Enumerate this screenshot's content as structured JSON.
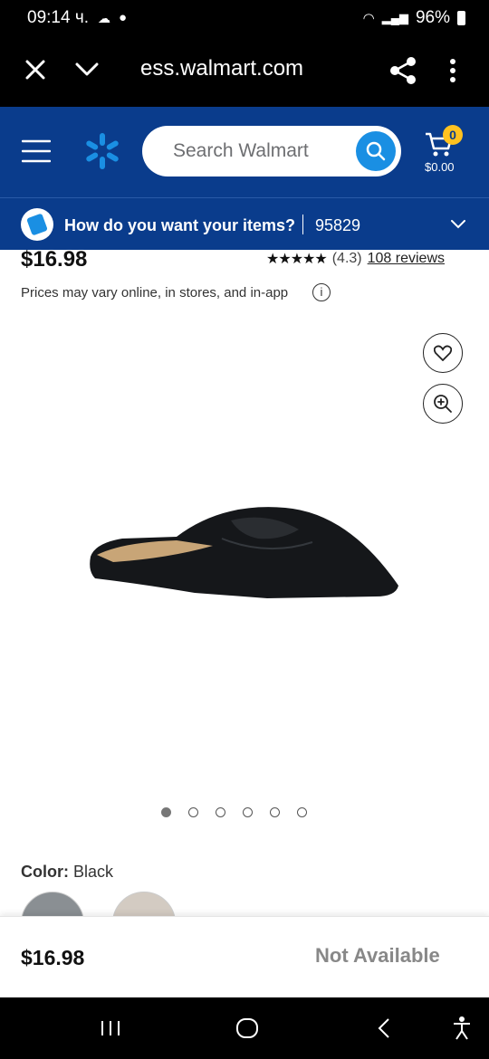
{
  "status_bar": {
    "time": "09:14 ч.",
    "battery": "96%"
  },
  "browser": {
    "url": "ess.walmart.com"
  },
  "header": {
    "search_placeholder": "Search Walmart",
    "cart_count": "0",
    "cart_total": "$0.00",
    "delivery_prompt": "How do you want your items?",
    "zip": "95829"
  },
  "product": {
    "price": "$16.98",
    "rating_stars": "★★★★★",
    "rating_value": "(4.3)",
    "reviews": "108 reviews",
    "disclaimer": "Prices may vary online, in stores, and in-app",
    "image_count": 6,
    "color_label": "Color:",
    "color_value": "Black"
  },
  "bottom": {
    "price": "$16.98",
    "availability": "Not Available"
  }
}
